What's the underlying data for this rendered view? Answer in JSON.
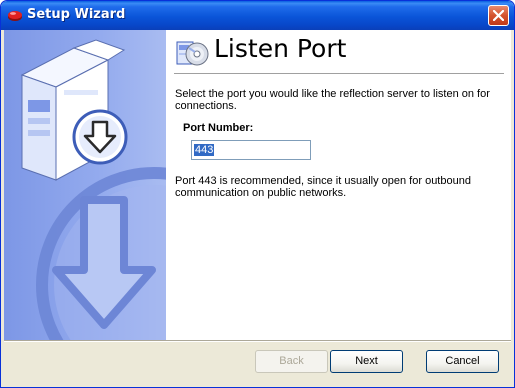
{
  "window": {
    "title": "Setup Wizard"
  },
  "page": {
    "heading": "Listen Port",
    "description": "Select the port you would like the reflection server to listen on for connections.",
    "port_label": "Port Number:",
    "port_value": "443",
    "note": "Port 443 is recommended, since it usually open for outbound communication on public networks."
  },
  "buttons": {
    "back": "Back",
    "next": "Next",
    "cancel": "Cancel"
  },
  "colors": {
    "titlebar": "#0a54d8",
    "side_panel": "#94abee",
    "selection": "#316ac5"
  }
}
